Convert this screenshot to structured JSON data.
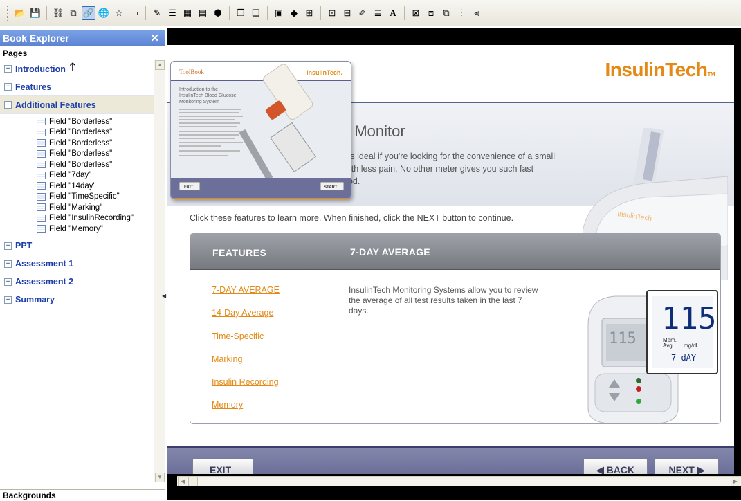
{
  "explorer": {
    "title": "Book Explorer",
    "close": "✕",
    "pages_label": "Pages",
    "sections": [
      {
        "label": "Introduction",
        "state": "+"
      },
      {
        "label": "Features",
        "state": "+"
      },
      {
        "label": "Additional Features",
        "state": "−"
      }
    ],
    "fields": [
      "Field \"Borderless\"",
      "Field \"Borderless\"",
      "Field \"Borderless\"",
      "Field \"Borderless\"",
      "Field \"Borderless\"",
      "Field \"7day\"",
      "Field \"14day\"",
      "Field \"TimeSpecific\"",
      "Field \"Marking\"",
      "Field \"InsulinRecording\"",
      "Field \"Memory\""
    ],
    "sections_after": [
      {
        "label": "PPT",
        "state": "+"
      },
      {
        "label": "Assessment 1",
        "state": "+"
      },
      {
        "label": "Assessment 2",
        "state": "+"
      },
      {
        "label": "Summary",
        "state": "+"
      }
    ],
    "bottom_label": "Backgrounds"
  },
  "page": {
    "logo": "InsulinTech",
    "logo_tm": "TM",
    "heading": "e Monitor",
    "intro_lines": [
      "r is ideal if you're looking for the convenience of a small",
      "with less pain. No other meter gives you such fast",
      "ood."
    ],
    "instructions": "Click these features to learn more. When finished, click the NEXT button to continue.",
    "features_header": "FEATURES",
    "detail_header": "7-DAY AVERAGE",
    "features": [
      "7-DAY AVERAGE",
      "14-Day Average",
      "Time-Specific",
      "Marking",
      "Insulin Recording",
      "Memory"
    ],
    "detail_text": "InsulinTech Monitoring Systems allow you to review the average of all test results taken in the last 7 days.",
    "meter": {
      "big_value": "115",
      "small_value": "115",
      "mem_label": "Mem.",
      "avg_label": "Avg.",
      "unit": "mg/dl",
      "days": "7 dAY"
    }
  },
  "nav": {
    "exit": "EXIT",
    "back": "◀ BACK",
    "next": "NEXT ▶"
  },
  "thumb": {
    "brand_left": "ToolBook",
    "brand_right": "InsulinTech.",
    "title_lines": [
      "Introduction to the",
      "InsulinTech Blood Glucose",
      "Monitoring System"
    ],
    "exit": "EXIT",
    "start": "START"
  },
  "colors": {
    "accent": "#e38a16",
    "nav": "#5b5f8d",
    "explorer_title": "#5b83d3",
    "link": "#1f3fa8"
  }
}
